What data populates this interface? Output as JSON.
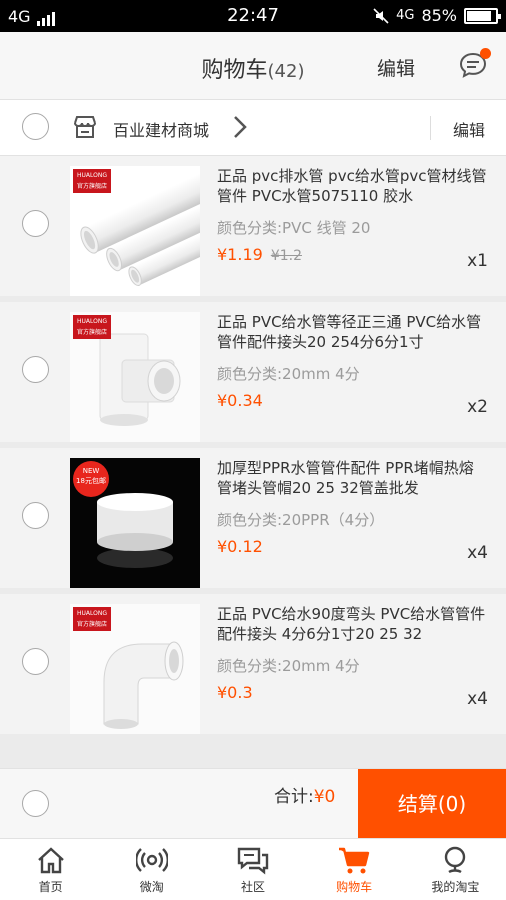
{
  "status_bar": {
    "network": "4G",
    "time": "22:47",
    "network_right": "4G",
    "battery": "85%"
  },
  "header": {
    "title": "购物车",
    "count": "(42)",
    "edit": "编辑"
  },
  "shop": {
    "name": "百业建材商城",
    "edit": "编辑"
  },
  "items": [
    {
      "title": "正品 pvc排水管 pvc给水管pvc管材线管管件 PVC水管5075110 胶水",
      "spec": "颜色分类:PVC 线管 20",
      "price": "¥1.19",
      "old_price": "¥1.2",
      "qty": "x1"
    },
    {
      "title": "正品 PVC给水管等径正三通 PVC给水管管件配件接头20 254分6分1寸",
      "spec": "颜色分类:20mm 4分",
      "price": "¥0.34",
      "old_price": "",
      "qty": "x2"
    },
    {
      "title": "加厚型PPR水管管件配件 PPR堵帽热熔管堵头管帽20 25 32管盖批发",
      "spec": "颜色分类:20PPR（4分）",
      "price": "¥0.12",
      "old_price": "",
      "qty": "x4"
    },
    {
      "title": "正品 PVC给水90度弯头 PVC给水管管件配件接头 4分6分1寸20 25 32",
      "spec": "颜色分类:20mm  4分",
      "price": "¥0.3",
      "old_price": "",
      "qty": "x4"
    }
  ],
  "badges": {
    "brand_line1": "HUALONG",
    "brand_line2": "官方旗舰店",
    "new_line1": "NEW",
    "new_line2": "18元包邮"
  },
  "footer": {
    "total_label": "合计:",
    "total_value": "¥0",
    "checkout": "结算(0)"
  },
  "tabs": [
    {
      "label": "首页",
      "icon": "home-icon"
    },
    {
      "label": "微淘",
      "icon": "broadcast-icon"
    },
    {
      "label": "社区",
      "icon": "community-icon"
    },
    {
      "label": "购物车",
      "icon": "cart-icon",
      "active": true
    },
    {
      "label": "我的淘宝",
      "icon": "profile-icon"
    }
  ],
  "colors": {
    "accent": "#ff5000",
    "statusbar": "#000000",
    "background": "#ebebeb"
  },
  "battery_level": 0.85
}
